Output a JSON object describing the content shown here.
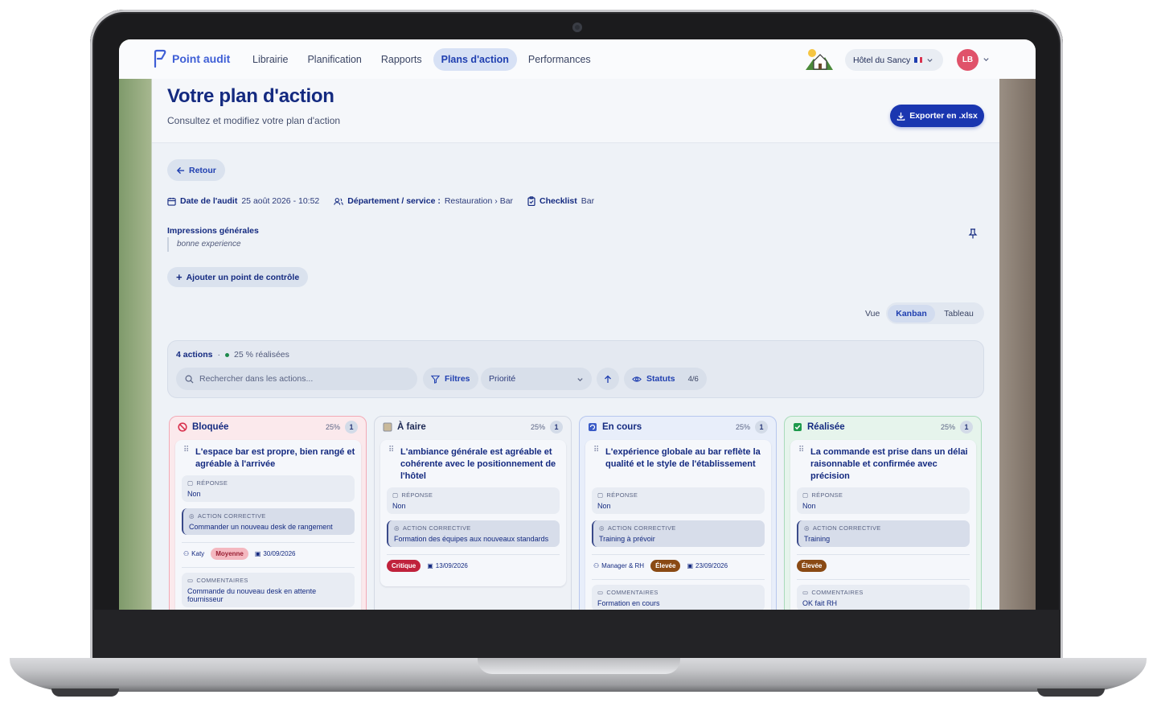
{
  "app": {
    "brand": "Point audit",
    "nav": [
      "Librairie",
      "Planification",
      "Rapports",
      "Plans d'action",
      "Performances"
    ],
    "hotel": "Hôtel du Sancy",
    "avatar": "LB"
  },
  "page": {
    "title": "Votre plan d'action",
    "subtitle": "Consultez et modifiez votre plan d'action",
    "export_label": "Exporter en .xlsx",
    "back_label": "Retour",
    "audit_date_label": "Date de l'audit",
    "audit_date": "25 août 2026 - 10:52",
    "department_label": "Département / service :",
    "department": "Restauration › Bar",
    "checklist_label": "Checklist",
    "checklist": "Bar",
    "impressions_label": "Impressions générales",
    "impressions": "bonne experience",
    "add_label": "Ajouter un point de contrôle",
    "view_label": "Vue",
    "view_options": [
      "Kanban",
      "Tableau"
    ]
  },
  "toolbar": {
    "actions_count": "4 actions",
    "done_pct": "25 % réalisées",
    "search_placeholder": "Rechercher dans les actions...",
    "filters_label": "Filtres",
    "priority_label": "Priorité",
    "statuses_label": "Statuts",
    "statuses_count": "4/6"
  },
  "labels": {
    "response": "RÉPONSE",
    "corrective": "ACTION CORRECTIVE",
    "comments": "COMMENTAIRES"
  },
  "columns": [
    {
      "name": "Bloquée",
      "pct": "25%",
      "count": "1",
      "accent": "#d9334f",
      "bg": "#fbe9ec",
      "border": "#f2aab6",
      "card": {
        "title": "L'espace bar est propre, bien rangé et agréable à l'arrivée",
        "response": "Non",
        "action": "Commander un nouveau desk de rangement",
        "assignee": "Katy",
        "priority": "Moyenne",
        "date": "30/09/2026",
        "comment": "Commande du nouveau desk en attente fournisseur"
      }
    },
    {
      "name": "À faire",
      "pct": "25%",
      "count": "1",
      "accent": "#8a8f9c",
      "bg": "#eef1f6",
      "border": "#d3d9e4",
      "card": {
        "title": "L'ambiance générale est agréable et cohérente avec le positionnement de l'hôtel",
        "response": "Non",
        "action": "Formation des équipes aux nouveaux standards",
        "priority": "Critique",
        "date": "13/09/2026"
      }
    },
    {
      "name": "En cours",
      "pct": "25%",
      "count": "1",
      "accent": "#3a5bc7",
      "bg": "#e8eefa",
      "border": "#b7c7ee",
      "card": {
        "title": "L'expérience globale au bar reflète la qualité et le style de l'établissement",
        "response": "Non",
        "action": "Training à prévoir",
        "assignee": "Manager & RH",
        "priority": "Élevée",
        "date": "23/09/2026",
        "comment": "Formation en cours"
      }
    },
    {
      "name": "Réalisée",
      "pct": "25%",
      "count": "1",
      "accent": "#1e9a4c",
      "bg": "#e6f4ec",
      "border": "#a9dbbb",
      "card": {
        "title": "La commande est prise dans un délai raisonnable et confirmée avec précision",
        "response": "Non",
        "action": "Training",
        "priority": "Élevée",
        "comment": "OK fait RH"
      }
    }
  ]
}
